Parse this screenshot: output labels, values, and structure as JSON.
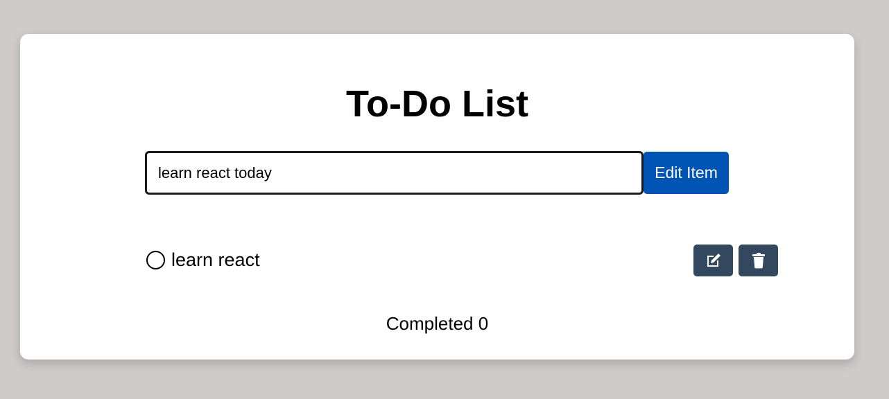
{
  "app": {
    "title": "To-Do List"
  },
  "form": {
    "input_value": "learn react today",
    "submit_label": "Edit Item"
  },
  "todos": [
    {
      "text": "learn react",
      "completed": false,
      "edit_icon": "edit-icon",
      "delete_icon": "trash-icon"
    }
  ],
  "footer": {
    "completed_text": "Completed 0"
  },
  "colors": {
    "background": "#cfcbca",
    "card": "#ffffff",
    "primary_button": "#0054b4",
    "icon_button": "#33475f"
  }
}
